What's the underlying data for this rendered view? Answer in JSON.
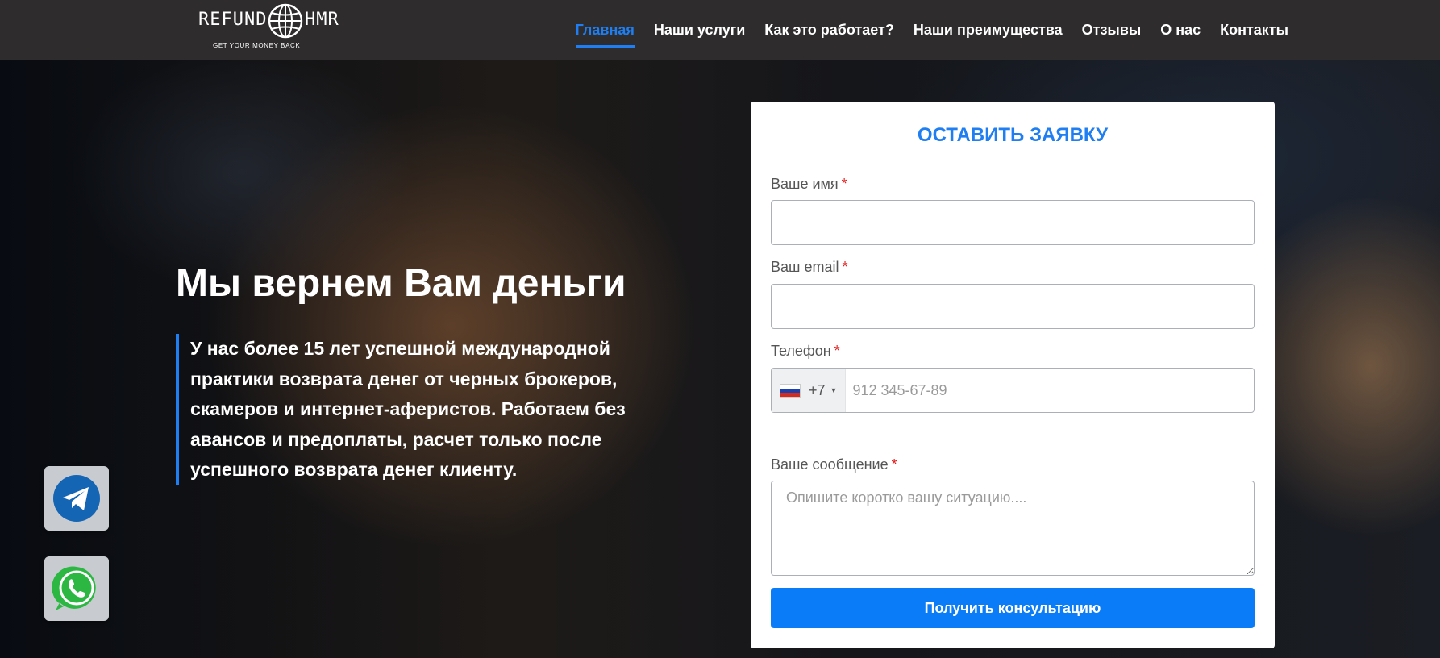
{
  "logo": {
    "left_word": "REFUND",
    "right_word": "HMR",
    "tagline": "GET YOUR MONEY BACK",
    "icon": "globe-icon"
  },
  "nav": {
    "items": [
      {
        "label": "Главная",
        "active": true
      },
      {
        "label": "Наши услуги",
        "active": false
      },
      {
        "label": "Как это работает?",
        "active": false
      },
      {
        "label": "Наши преимущества",
        "active": false
      },
      {
        "label": "Отзывы",
        "active": false
      },
      {
        "label": "О нас",
        "active": false
      },
      {
        "label": "Контакты",
        "active": false
      }
    ]
  },
  "hero": {
    "title": "Мы вернем Вам деньги",
    "description": "У нас более 15 лет успешной международной практики возврата денег от черных брокеров, скамеров и интернет-аферистов. Работаем без авансов и предоплаты, расчет только после успешного возврата денег клиенту."
  },
  "social": {
    "telegram_icon": "telegram-icon",
    "whatsapp_icon": "whatsapp-icon"
  },
  "form": {
    "title": "ОСТАВИТЬ ЗАЯВКУ",
    "required_mark": "*",
    "name": {
      "label": "Ваше имя",
      "value": "",
      "placeholder": ""
    },
    "email": {
      "label": "Ваш email",
      "value": "",
      "placeholder": ""
    },
    "phone": {
      "label": "Телефон",
      "country_flag": "russia-flag-icon",
      "dial_code": "+7",
      "value": "",
      "placeholder": "912 345-67-89"
    },
    "message": {
      "label": "Ваше сообщение",
      "value": "",
      "placeholder": "Опишите коротко вашу ситуацию...."
    },
    "submit_label": "Получить консультацию"
  },
  "colors": {
    "accent": "#1e7ef2",
    "button": "#0a7cf7",
    "header_bg": "#2e2c2c",
    "required": "#e21b1b"
  }
}
